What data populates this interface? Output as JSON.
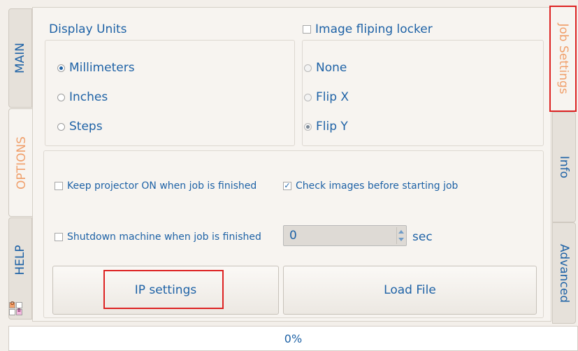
{
  "left_tabs": [
    {
      "label": "MAIN",
      "active": false
    },
    {
      "label": "OPTIONS",
      "active": true
    },
    {
      "label": "HELP",
      "active": false
    }
  ],
  "right_tabs": [
    {
      "label": "Job Settings",
      "active": true
    },
    {
      "label": "Info",
      "active": false
    },
    {
      "label": "Advanced",
      "active": false
    }
  ],
  "display_units": {
    "title": "Display Units",
    "options": [
      "Millimeters",
      "Inches",
      "Steps"
    ],
    "selected": "Millimeters"
  },
  "image_flip": {
    "locker_label": "Image fliping locker",
    "locker_checked": false,
    "options": [
      "None",
      "Flip X",
      "Flip Y"
    ],
    "selected": "Flip Y"
  },
  "job_options": {
    "keep_projector_label": "Keep projector ON when job is finished",
    "keep_projector_checked": false,
    "check_images_label": "Check images before starting job",
    "check_images_checked": true,
    "shutdown_label": "Shutdown machine when job is finished",
    "shutdown_checked": false,
    "shutdown_delay_value": "0",
    "shutdown_delay_unit": "sec"
  },
  "buttons": {
    "ip_settings": "IP settings",
    "load_file": "Load File"
  },
  "progress": {
    "value_text": "0%",
    "value": 0
  },
  "theme_squares": {
    "orange_label": "O",
    "blue_label": "B"
  },
  "colors": {
    "text_blue": "#1e62a6",
    "active_tab_orange": "#f0a06c",
    "highlight_red": "#dd2222"
  }
}
